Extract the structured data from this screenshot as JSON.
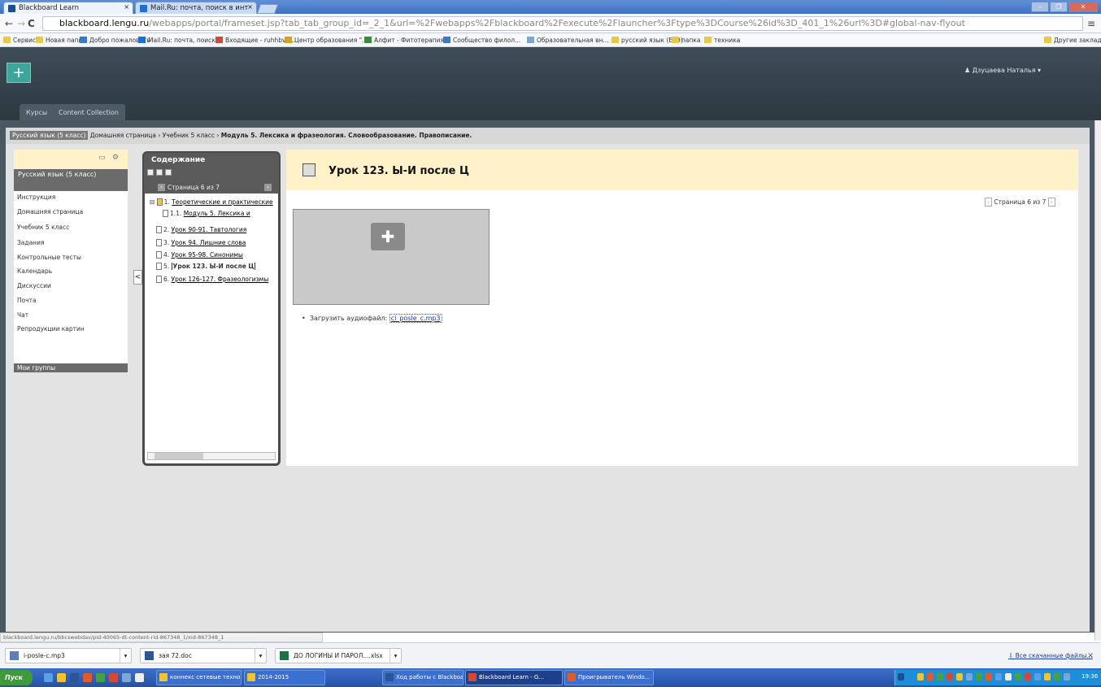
{
  "browser": {
    "tabs": [
      {
        "label": "Blackboard Learn",
        "close": "×"
      },
      {
        "label": "Mail.Ru: почта, поиск в инт",
        "close": "×"
      }
    ],
    "window_buttons": [
      "–",
      "❐",
      "✕"
    ],
    "url_host": "blackboard.lengu.ru",
    "url_rest": "/webapps/portal/frameset.jsp?tab_tab_group_id=_2_1&url=%2Fwebapps%2Fblackboard%2Fexecute%2Flauncher%3Ftype%3DCourse%26id%3D_401_1%26url%3D#global-nav-flyout",
    "bookmarks": [
      "Сервисы",
      "Новая папка",
      "Добро пожаловать",
      "Mail.Ru: почта, поиск...",
      "Входящие - ruhhbva...",
      "Центр образования \"...",
      "Алфит - Фитотерапия",
      "Сообщество филол...",
      "Образовательная вн...",
      "русский язык (ЕГЭ)",
      "папка",
      "техника",
      "Другие закладки"
    ]
  },
  "blackboard": {
    "plus": "+",
    "user_name": "Дзуцаева Наталья",
    "nav_tabs": [
      "Курсы",
      "Content Collection"
    ],
    "breadcrumb": {
      "course": "Русский язык (5 класс)",
      "path": "Домашняя страница › Учебник 5 класс › ",
      "current": "Модуль 5. Лексика и фразеология. Словообразование. Правописание."
    },
    "course_menu": {
      "title": "Русский язык (5 класс)",
      "items": [
        "Инструкция",
        "Домашняя страница",
        "Учебник 5 класс",
        "Задания",
        "Контрольные тесты",
        "Календарь",
        "Дискуссии",
        "Почта",
        "Чат",
        "Репродукции картин"
      ],
      "groups": "Мои группы",
      "collapse": "<"
    },
    "toc": {
      "title": "Содержание",
      "page_label": "Страница 6 из 7",
      "items": [
        {
          "num": "1.",
          "text": "Теоретические и практические"
        },
        {
          "num": "1.1.",
          "text": "Модуль 5. Лексика и"
        },
        {
          "num": "2.",
          "text": "Урок 90-91. Тавтология"
        },
        {
          "num": "3.",
          "text": "Урок 94. Лишние слова"
        },
        {
          "num": "4.",
          "text": "Урок 95-98. Синонимы"
        },
        {
          "num": "5.",
          "text": "Урок 123. Ы-И после Ц"
        },
        {
          "num": "6.",
          "text": "Урок 126-127. Фразеологизмы"
        }
      ]
    },
    "content": {
      "title": "Урок 123. Ы-И после Ц",
      "pager": "Страница 6 из 7",
      "audio_label": "Загрузить аудиофайл:",
      "audio_file": "ci_posle_c.mp3"
    }
  },
  "status_url": "blackboard.lengu.ru/bbcswebdav/pid-40065-dt-content-rid-867348_1/xid-867348_1",
  "downloads": {
    "items": [
      {
        "name": "i-posle-c.mp3",
        "menu": "▾"
      },
      {
        "name": "зая 72.doc",
        "menu": "▾"
      },
      {
        "name": "ДО ЛОГИНЫ И ПАРОЛ....xlsx",
        "menu": "▾"
      }
    ],
    "all_link": "Все скачанные файлы...",
    "close": "×"
  },
  "taskbar": {
    "start": "Пуск",
    "tasks": [
      "коннекс сетевые техно...",
      "2014-2015",
      "Ход работы с Blackboar...",
      "Blackboard Learn - G...",
      "Проигрыватель Windo..."
    ],
    "clock": "19:36"
  },
  "colors": {
    "accent": "#3fa59a",
    "header_dark": "#2d3840",
    "content_header": "#fff2c8",
    "menu_title": "#6b6b6b"
  }
}
